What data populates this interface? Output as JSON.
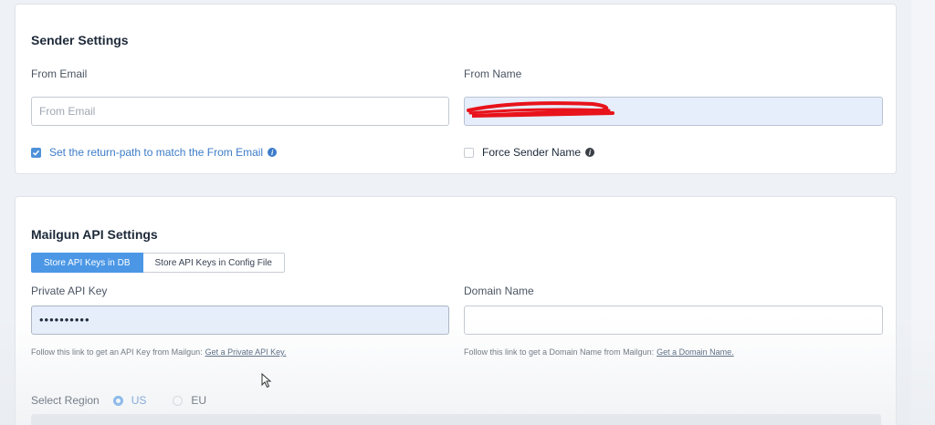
{
  "sender": {
    "title": "Sender Settings",
    "from_email_label": "From Email",
    "from_email_placeholder": "From Email",
    "from_name_label": "From Name",
    "return_path_label": "Set the return-path to match the From Email",
    "return_path_checked": true,
    "force_sender_label": "Force Sender Name",
    "force_sender_checked": false
  },
  "mailgun": {
    "title": "Mailgun API Settings",
    "tabs": [
      {
        "label": "Store API Keys in DB",
        "active": true
      },
      {
        "label": "Store API Keys in Config File",
        "active": false
      }
    ],
    "private_key_label": "Private API Key",
    "private_key_value": "••••••••••",
    "domain_label": "Domain Name",
    "private_key_help": "Follow this link to get an API Key from Mailgun:",
    "private_key_link": "Get a Private API Key.",
    "domain_help": "Follow this link to get a Domain Name from Mailgun:",
    "domain_link": "Get a Domain Name.",
    "region_label": "Select Region",
    "regions": [
      {
        "label": "US",
        "selected": true
      },
      {
        "label": "EU",
        "selected": false
      }
    ]
  },
  "colors": {
    "accent": "#4b97e6",
    "checkbox_label": "#3d7cc9",
    "redaction": "#e8131b"
  },
  "icons": {
    "info": "info-icon",
    "check": "check-icon",
    "cursor": "mouse-cursor-icon"
  }
}
